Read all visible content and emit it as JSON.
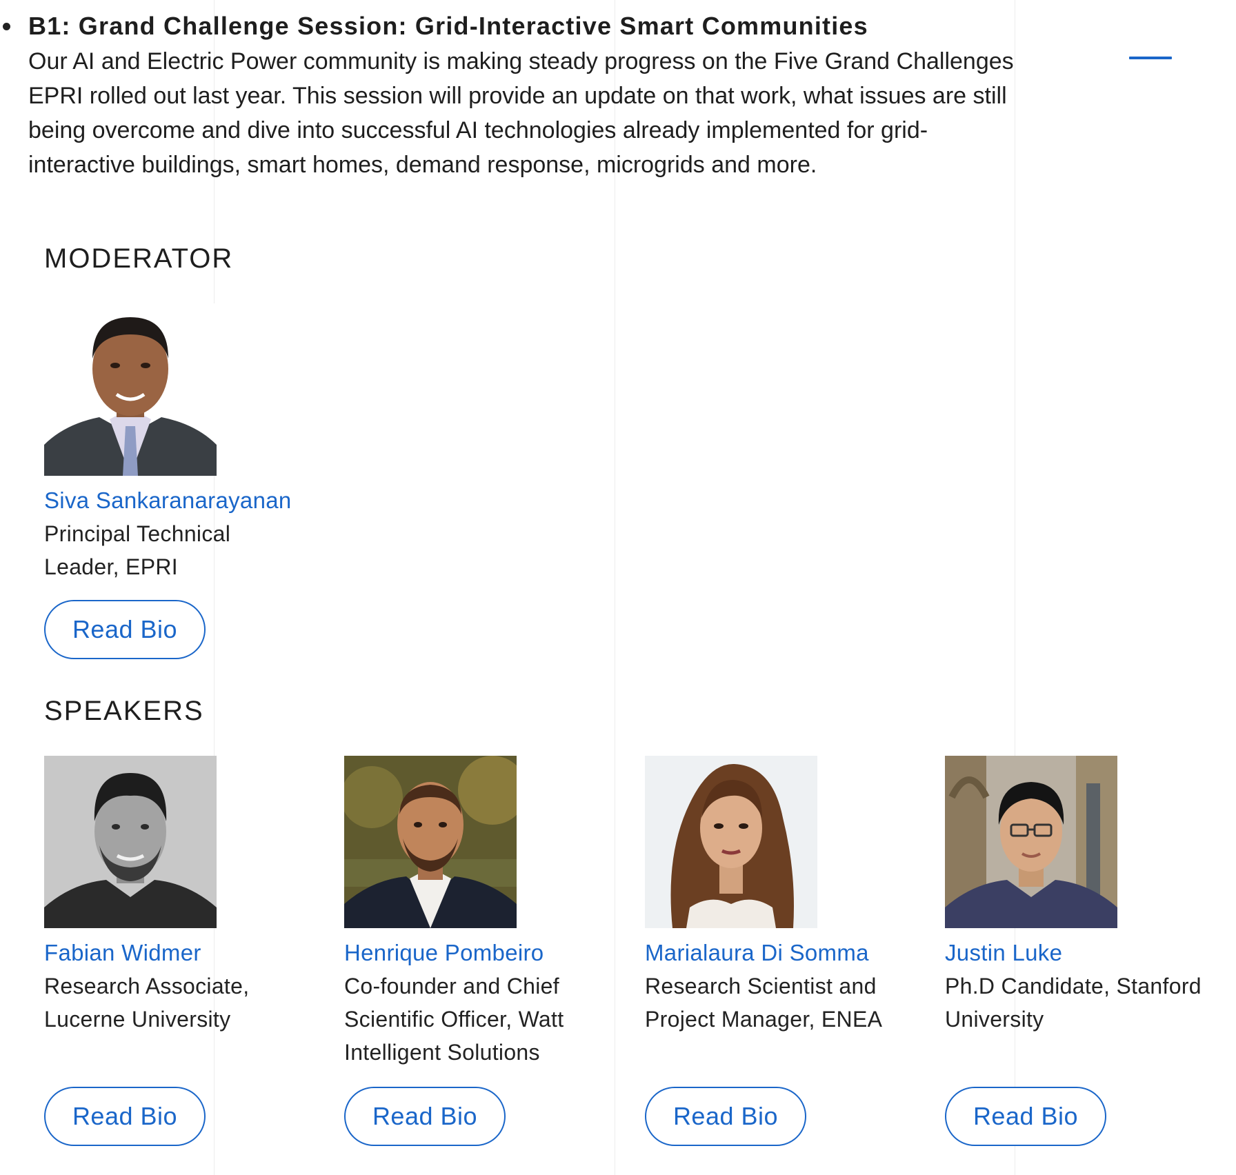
{
  "session": {
    "title": "B1: Grand Challenge Session: Grid-Interactive Smart Communities",
    "description_lines": [
      "Our AI and Electric Power community is making steady progress on the Five Grand Challenges",
      "EPRI rolled out last year. This session will provide an update on that work, what issues are still",
      "being overcome and dive into successful AI technologies already implemented for grid-",
      "interactive buildings, smart homes, demand response, microgrids and more."
    ],
    "accent_color": "#1a66c9"
  },
  "moderator_heading": "MODERATOR",
  "speakers_heading": "SPEAKERS",
  "moderator": {
    "name": "Siva Sankaranarayanan",
    "role_lines": [
      "Principal Technical",
      "Leader, EPRI"
    ],
    "button_label": "Read Bio"
  },
  "speakers": [
    {
      "name": "Fabian Widmer",
      "role_lines": [
        "Research Associate,",
        "Lucerne University"
      ],
      "button_label": "Read Bio"
    },
    {
      "name": "Henrique Pombeiro",
      "role_lines": [
        "Co-founder and Chief",
        "Scientific Officer, Watt",
        "Intelligent Solutions"
      ],
      "button_label": "Read Bio"
    },
    {
      "name": "Marialaura Di Somma",
      "role_lines": [
        "Research Scientist and",
        "Project Manager, ENEA"
      ],
      "button_label": "Read Bio"
    },
    {
      "name": "Justin Luke",
      "role_lines": [
        "Ph.D Candidate, Stanford",
        "University"
      ],
      "button_label": "Read Bio"
    }
  ]
}
